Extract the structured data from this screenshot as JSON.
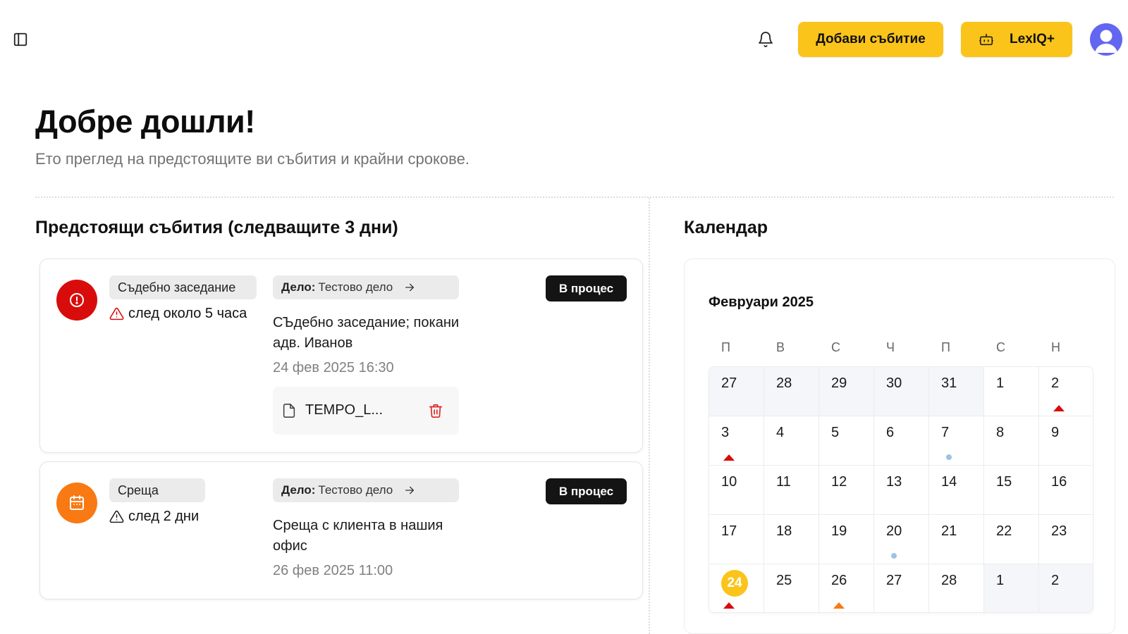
{
  "header": {
    "add_event_label": "Добави събитие",
    "assistant_label": "LexIQ+",
    "icons": [
      "sidebar-toggle-icon",
      "bell-icon",
      "robot-icon",
      "user-avatar"
    ]
  },
  "page": {
    "title": "Добре дошли!",
    "subtitle": "Ето преглед на предстоящите ви събития и крайни срокове."
  },
  "events_section": {
    "title": "Предстоящи събития (следващите 3 дни)",
    "events": [
      {
        "type": "Съдебно заседание",
        "time_until": "след около 5 часа",
        "case_prefix": "Дело:",
        "case_name": "Тестово дело",
        "description": "СЪдебно заседание; покани адв. Иванов",
        "datetime": "24 фев 2025 16:30",
        "status": "В процес",
        "icon": "alert-circle-icon",
        "icon_color": "#d90c0c",
        "attachment": "TEMPO_L..."
      },
      {
        "type": "Среща",
        "time_until": "след 2 дни",
        "case_prefix": "Дело:",
        "case_name": "Тестово дело",
        "description": "Среща с клиента в нашия офис",
        "datetime": "26 фев 2025 11:00",
        "status": "В процес",
        "icon": "calendar-icon",
        "icon_color": "#f97912"
      }
    ]
  },
  "calendar": {
    "title": "Календар",
    "month": "Февруари 2025",
    "weekdays": [
      "П",
      "В",
      "С",
      "Ч",
      "П",
      "С",
      "Н"
    ],
    "today": "24",
    "weeks": [
      [
        {
          "d": "27",
          "o": true
        },
        {
          "d": "28",
          "o": true
        },
        {
          "d": "29",
          "o": true
        },
        {
          "d": "30",
          "o": true
        },
        {
          "d": "31",
          "o": true
        },
        {
          "d": "1"
        },
        {
          "d": "2",
          "m": "red"
        }
      ],
      [
        {
          "d": "3",
          "m": "red"
        },
        {
          "d": "4"
        },
        {
          "d": "5"
        },
        {
          "d": "6"
        },
        {
          "d": "7",
          "m": "dot"
        },
        {
          "d": "8"
        },
        {
          "d": "9"
        }
      ],
      [
        {
          "d": "10"
        },
        {
          "d": "11"
        },
        {
          "d": "12"
        },
        {
          "d": "13"
        },
        {
          "d": "14"
        },
        {
          "d": "15"
        },
        {
          "d": "16"
        }
      ],
      [
        {
          "d": "17"
        },
        {
          "d": "18"
        },
        {
          "d": "19"
        },
        {
          "d": "20",
          "m": "dot"
        },
        {
          "d": "21"
        },
        {
          "d": "22"
        },
        {
          "d": "23"
        }
      ],
      [
        {
          "d": "24",
          "m": "red",
          "t": true
        },
        {
          "d": "25"
        },
        {
          "d": "26",
          "m": "orange"
        },
        {
          "d": "27"
        },
        {
          "d": "28"
        },
        {
          "d": "1",
          "o": true
        },
        {
          "d": "2",
          "o": true
        }
      ]
    ],
    "colors": {
      "red": "#d90c0c",
      "orange": "#f97912",
      "dot": "#9ec1e6",
      "today": "#fbc41b"
    }
  }
}
